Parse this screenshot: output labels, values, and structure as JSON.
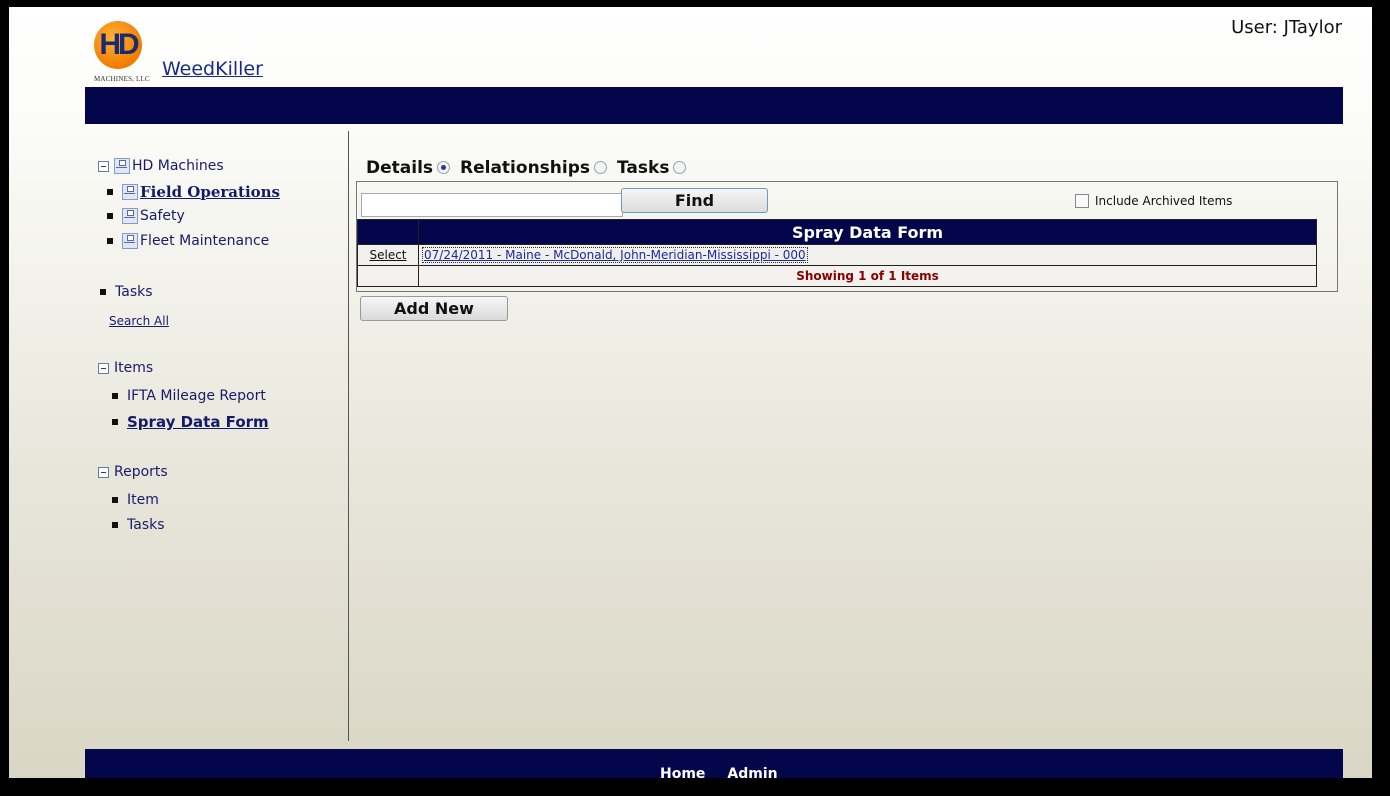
{
  "header": {
    "logo_text": "HD",
    "logo_subtext": "MACHINES, LLC",
    "app_title": "WeedKiller",
    "user_label": "User: JTaylor"
  },
  "sidebar": {
    "org_tree": {
      "root": "HD Machines",
      "children": [
        "Field Operations",
        "Safety",
        "Fleet Maintenance"
      ]
    },
    "tasks": {
      "label": "Tasks",
      "search_all": "Search All"
    },
    "items": {
      "label": "Items",
      "children": [
        "IFTA Mileage Report",
        "Spray Data Form"
      ]
    },
    "reports": {
      "label": "Reports",
      "children": [
        "Item",
        "Tasks"
      ]
    }
  },
  "main": {
    "tabs": [
      {
        "label": "Details",
        "selected": true
      },
      {
        "label": "Relationships",
        "selected": false
      },
      {
        "label": "Tasks",
        "selected": false
      }
    ],
    "search": {
      "value": "",
      "find_label": "Find",
      "include_archived_label": "Include Archived Items",
      "include_archived_checked": false
    },
    "grid": {
      "header": "Spray Data Form",
      "rows": [
        {
          "select": "Select",
          "record": "07/24/2011 - Maine - McDonald, John-Meridian-Mississippi - 000"
        }
      ],
      "pager_text": "Showing 1 of 1 Items"
    },
    "add_new_label": "Add New"
  },
  "footer": {
    "links": [
      "Home",
      "Admin"
    ]
  },
  "colors": {
    "nav_bar": "#03064a",
    "link": "#1a2a8a",
    "pager_text": "#8a0000"
  }
}
